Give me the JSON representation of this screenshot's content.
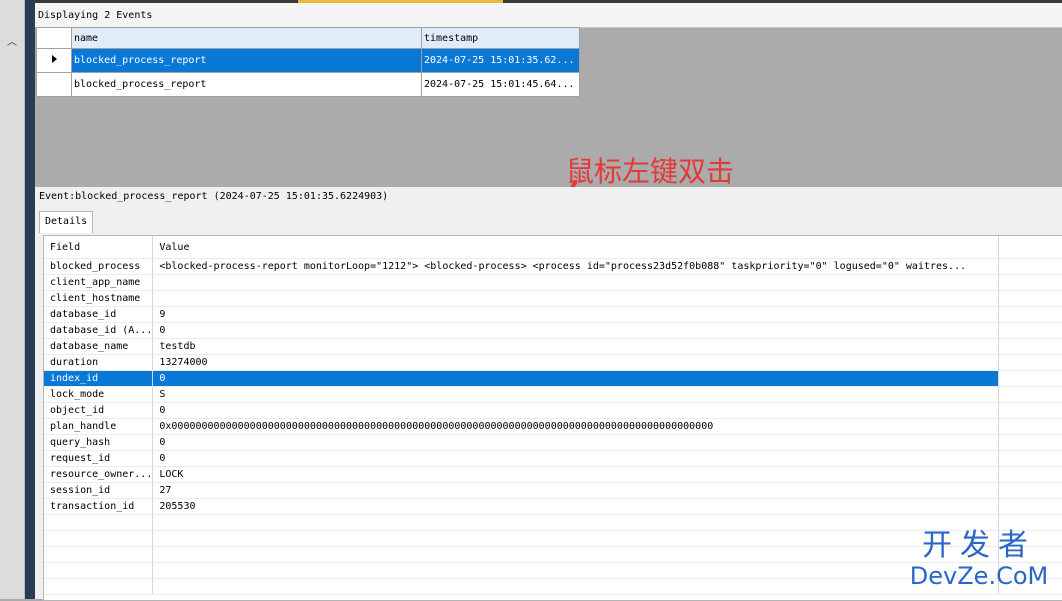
{
  "events_header": "Displaying 2 Events",
  "event_grid": {
    "columns": [
      "name",
      "timestamp"
    ],
    "rows": [
      {
        "name": "blocked_process_report",
        "timestamp": "2024-07-25 15:01:35.62...",
        "selected": true
      },
      {
        "name": "blocked_process_report",
        "timestamp": "2024-07-25 15:01:45.64...",
        "selected": false
      }
    ]
  },
  "annotation": "鼠标左键双击",
  "event_title": "Event:blocked_process_report (2024-07-25 15:01:35.6224903)",
  "tab_details": "Details",
  "details": {
    "headers": {
      "field": "Field",
      "value": "Value"
    },
    "rows": [
      {
        "field": "blocked_process",
        "value": "<blocked-process-report monitorLoop=\"1212\">   <blocked-process>    <process id=\"process23d52f0b088\" taskpriority=\"0\" logused=\"0\" waitres..."
      },
      {
        "field": "client_app_name",
        "value": ""
      },
      {
        "field": "client_hostname",
        "value": ""
      },
      {
        "field": "database_id",
        "value": "9"
      },
      {
        "field": "database_id (A...",
        "value": "0"
      },
      {
        "field": "database_name",
        "value": "testdb"
      },
      {
        "field": "duration",
        "value": "13274000"
      },
      {
        "field": "index_id",
        "value": "0"
      },
      {
        "field": "lock_mode",
        "value": "S"
      },
      {
        "field": "object_id",
        "value": "0"
      },
      {
        "field": "plan_handle",
        "value": "0x000000000000000000000000000000000000000000000000000000000000000000000000000000000000000000"
      },
      {
        "field": "query_hash",
        "value": "0"
      },
      {
        "field": "request_id",
        "value": "0"
      },
      {
        "field": "resource_owner...",
        "value": "LOCK"
      },
      {
        "field": "session_id",
        "value": "27"
      },
      {
        "field": "transaction_id",
        "value": "205530"
      }
    ],
    "selected_field": "index_id"
  },
  "watermark": {
    "cn": "开发者",
    "en": "DevZe.CoM"
  },
  "colors": {
    "selection": "#0a78d7",
    "annotation": "#e53935",
    "watermark": "#2a66c8"
  }
}
